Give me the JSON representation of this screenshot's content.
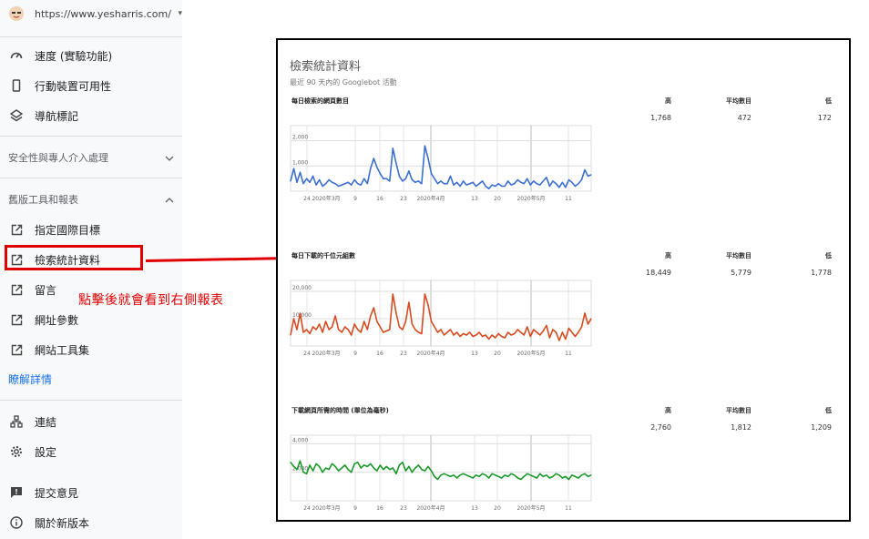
{
  "site": {
    "url": "https://www.yesharris.com/"
  },
  "nav_top": [
    {
      "label": "速度 (實驗功能)",
      "icon": "speedometer-icon"
    },
    {
      "label": "行動裝置可用性",
      "icon": "smartphone-icon"
    },
    {
      "label": "導航標記",
      "icon": "layers-icon"
    }
  ],
  "section_security": {
    "label": "安全性與專人介入處理"
  },
  "section_legacy": {
    "label": "舊版工具和報表"
  },
  "nav_legacy": [
    {
      "label": "指定國際目標",
      "icon": "external-link-icon"
    },
    {
      "label": "檢索統計資料",
      "icon": "external-link-icon"
    },
    {
      "label": "留言",
      "icon": "external-link-icon"
    },
    {
      "label": "網址參數",
      "icon": "external-link-icon"
    },
    {
      "label": "網站工具集",
      "icon": "external-link-icon"
    }
  ],
  "learn_more": "瞭解詳情",
  "nav_bottom": [
    {
      "label": "連結",
      "icon": "links-icon"
    },
    {
      "label": "設定",
      "icon": "settings-icon"
    },
    {
      "label": "提交意見",
      "icon": "feedback-icon"
    },
    {
      "label": "關於新版本",
      "icon": "info-icon"
    }
  ],
  "annotation": "點擊後就會看到右側報表",
  "report": {
    "title": "檢索統計資料",
    "subtitle": "最近 90 天內的 Googlebot 活動",
    "col_high": "高",
    "col_avg": "平均數目",
    "col_low": "低"
  },
  "chart_data": [
    {
      "type": "line",
      "title": "每日檢索的網頁數目",
      "stats": {
        "high": "1,768",
        "avg": "472",
        "low": "172"
      },
      "color": "#3b6fd4",
      "ylim": [
        0,
        2600
      ],
      "yticks": [
        {
          "v": 2000,
          "label": "2,000"
        },
        {
          "v": 1000,
          "label": "1,000"
        }
      ],
      "xlabels": [
        "24",
        "2020年3月",
        "9",
        "16",
        "23",
        "2020年4月",
        "13",
        "20",
        "2020年5月",
        "11"
      ],
      "values": [
        400,
        900,
        350,
        750,
        300,
        500,
        350,
        600,
        250,
        450,
        200,
        300,
        450,
        350,
        300,
        200,
        250,
        300,
        350,
        250,
        450,
        300,
        250,
        500,
        300,
        900,
        1300,
        950,
        700,
        500,
        500,
        400,
        1700,
        1100,
        600,
        400,
        500,
        800,
        450,
        350,
        400,
        300,
        1800,
        1300,
        700,
        500,
        300,
        400,
        300,
        300,
        600,
        250,
        350,
        200,
        400,
        250,
        300,
        350,
        200,
        300,
        400,
        200,
        100,
        250,
        200,
        300,
        200,
        200,
        400,
        250,
        300,
        450,
        350,
        300,
        500,
        250,
        400,
        300,
        250,
        400,
        550,
        200,
        400,
        300,
        150,
        350,
        150,
        450,
        350,
        200,
        300,
        450,
        850,
        600,
        650
      ]
    },
    {
      "type": "line",
      "title": "每日下載的千位元組數",
      "stats": {
        "high": "18,449",
        "avg": "5,779",
        "low": "1,778"
      },
      "color": "#d84a1f",
      "ylim": [
        0,
        24000
      ],
      "yticks": [
        {
          "v": 20000,
          "label": "20,000"
        },
        {
          "v": 10000,
          "label": "10,000"
        }
      ],
      "xlabels": [
        "24",
        "2020年3月",
        "9",
        "16",
        "23",
        "2020年4月",
        "13",
        "20",
        "2020年5月",
        "11"
      ],
      "values": [
        4000,
        10000,
        6000,
        12000,
        5000,
        6000,
        4500,
        7000,
        6000,
        8000,
        5000,
        9000,
        6000,
        7000,
        11000,
        6000,
        5000,
        7000,
        6000,
        4000,
        8000,
        6000,
        5000,
        9000,
        6000,
        11000,
        14000,
        9000,
        7000,
        5000,
        5500,
        6000,
        19000,
        12000,
        7000,
        6000,
        9000,
        16000,
        8000,
        6000,
        5000,
        4500,
        19000,
        15000,
        9000,
        7000,
        5000,
        6000,
        4000,
        5000,
        6000,
        4000,
        5000,
        3500,
        4500,
        4000,
        5000,
        3500,
        4000,
        5000,
        3500,
        4000,
        2500,
        4000,
        3000,
        4500,
        3500,
        3000,
        5000,
        4000,
        4500,
        6000,
        5000,
        4000,
        7000,
        3500,
        6000,
        5000,
        4000,
        5500,
        7500,
        3000,
        6000,
        5000,
        2000,
        5000,
        2500,
        6500,
        5000,
        3500,
        5000,
        7000,
        12000,
        8000,
        10000
      ]
    },
    {
      "type": "line",
      "title": "下載網頁所需的時間 (單位為毫秒)",
      "stats": {
        "high": "2,760",
        "avg": "1,812",
        "low": "1,209"
      },
      "color": "#1a9a2a",
      "ylim": [
        0,
        4600
      ],
      "yticks": [
        {
          "v": 4000,
          "label": "4,000"
        },
        {
          "v": 2000,
          "label": "2,000"
        }
      ],
      "xlabels": [
        "24",
        "2020年3月",
        "9",
        "16",
        "23",
        "2020年4月",
        "13",
        "20",
        "2020年5月",
        "11"
      ],
      "values": [
        2700,
        2400,
        2200,
        2800,
        2000,
        1900,
        2500,
        2100,
        2600,
        2400,
        2000,
        2300,
        2200,
        2600,
        2400,
        2100,
        2300,
        2500,
        2200,
        2000,
        2600,
        2700,
        2300,
        2500,
        2400,
        2600,
        2300,
        2100,
        2500,
        2200,
        2400,
        2200,
        2300,
        1900,
        2500,
        2700,
        2100,
        2400,
        2000,
        2300,
        2500,
        2200,
        2100,
        2400,
        2100,
        1700,
        1500,
        1800,
        1900,
        1800,
        1700,
        1800,
        1600,
        1800,
        1900,
        1800,
        1700,
        1600,
        1800,
        1700,
        1900,
        1800,
        1600,
        1900,
        1800,
        1700,
        1600,
        1800,
        1700,
        1900,
        1800,
        1600,
        1500,
        1700,
        1900,
        1800,
        1700,
        1600,
        1900,
        1700,
        1800,
        1600,
        1700,
        1900,
        1800,
        1600,
        1700,
        1500,
        1800,
        1700,
        1600,
        1800,
        1900,
        1700,
        1800
      ]
    }
  ]
}
